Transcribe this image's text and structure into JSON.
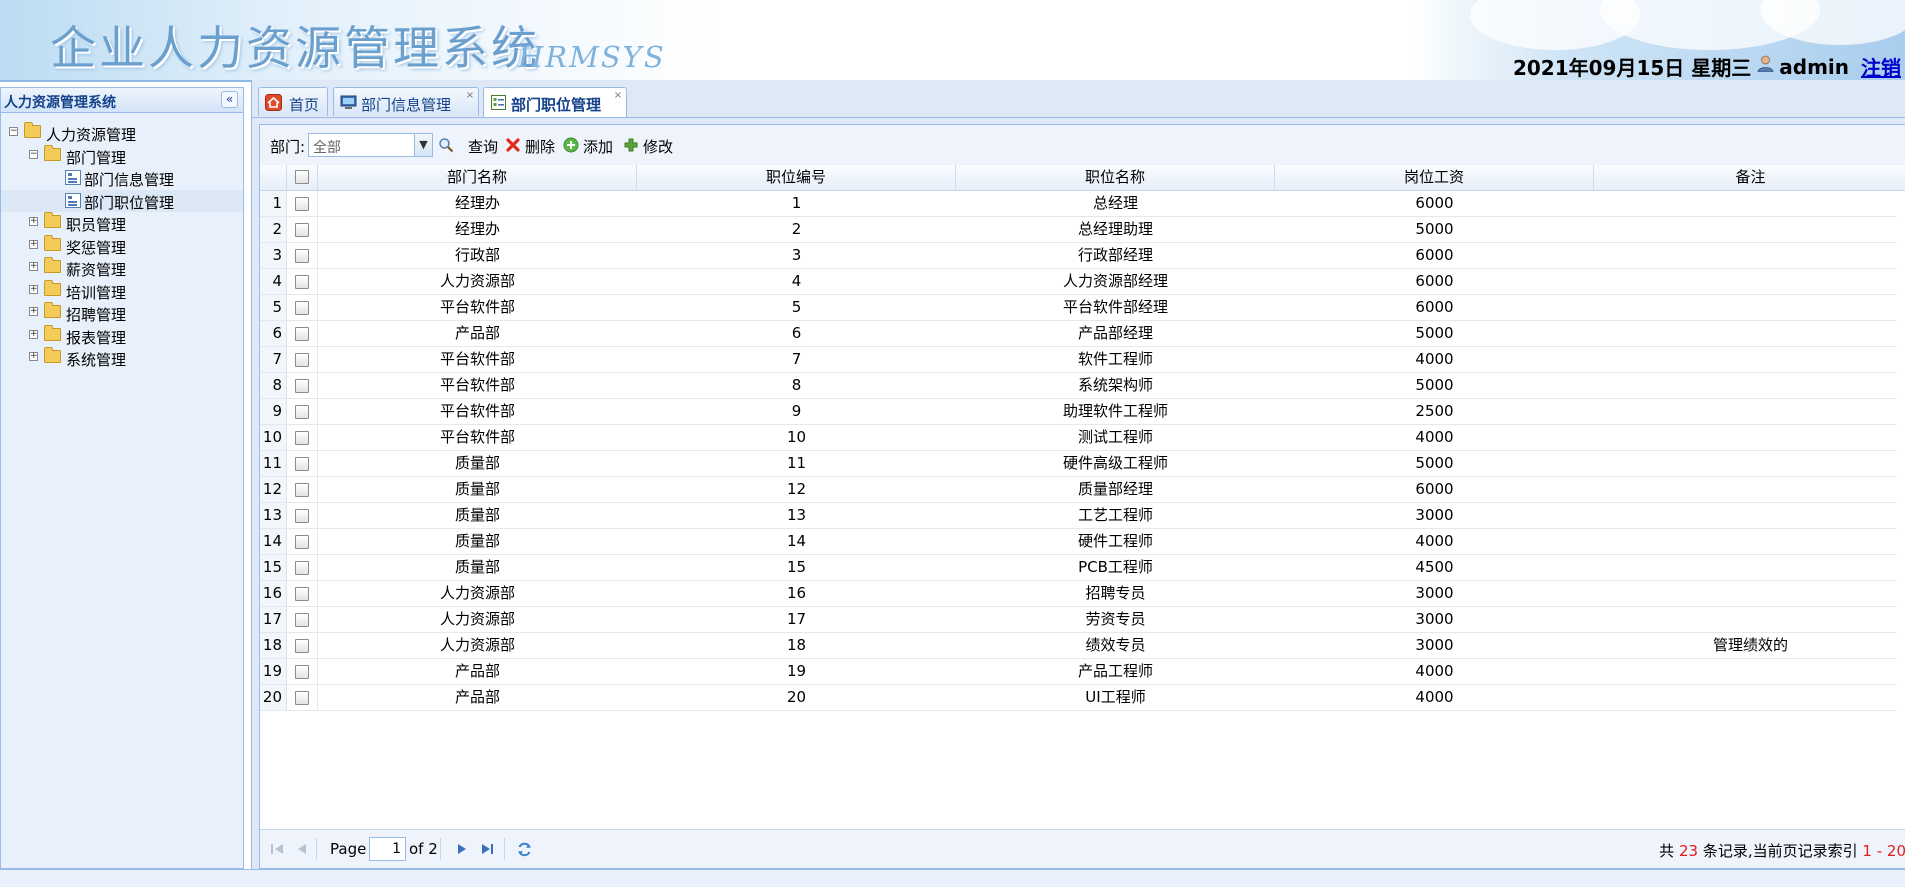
{
  "header": {
    "title": "企业人力资源管理系统",
    "subtitle": "HRMSYS",
    "datetime": "2021年09月15日 星期三",
    "username": "admin",
    "logout_label": "注销"
  },
  "sidebar": {
    "title": "人力资源管理系统",
    "tree": [
      {
        "label": "人力资源管理",
        "level": 0,
        "type": "folder",
        "expanded": true
      },
      {
        "label": "部门管理",
        "level": 1,
        "type": "folder",
        "expanded": true
      },
      {
        "label": "部门信息管理",
        "level": 2,
        "type": "page"
      },
      {
        "label": "部门职位管理",
        "level": 2,
        "type": "page",
        "selected": true
      },
      {
        "label": "职员管理",
        "level": 1,
        "type": "folder",
        "expanded": false
      },
      {
        "label": "奖惩管理",
        "level": 1,
        "type": "folder",
        "expanded": false
      },
      {
        "label": "薪资管理",
        "level": 1,
        "type": "folder",
        "expanded": false
      },
      {
        "label": "培训管理",
        "level": 1,
        "type": "folder",
        "expanded": false
      },
      {
        "label": "招聘管理",
        "level": 1,
        "type": "folder",
        "expanded": false
      },
      {
        "label": "报表管理",
        "level": 1,
        "type": "folder",
        "expanded": false
      },
      {
        "label": "系统管理",
        "level": 1,
        "type": "folder",
        "expanded": false
      }
    ]
  },
  "tabs": [
    {
      "label": "首页",
      "icon": "home-icon",
      "closable": false,
      "active": false
    },
    {
      "label": "部门信息管理",
      "icon": "monitor-icon",
      "closable": true,
      "active": false
    },
    {
      "label": "部门职位管理",
      "icon": "form-icon",
      "closable": true,
      "active": true
    }
  ],
  "toolbar": {
    "dept_label": "部门:",
    "dept_value": "全部",
    "query_label": "查询",
    "delete_label": "删除",
    "add_label": "添加",
    "edit_label": "修改"
  },
  "table": {
    "columns": [
      "部门名称",
      "职位编号",
      "职位名称",
      "岗位工资",
      "备注"
    ],
    "rows": [
      [
        "经理办",
        "1",
        "总经理",
        "6000",
        ""
      ],
      [
        "经理办",
        "2",
        "总经理助理",
        "5000",
        ""
      ],
      [
        "行政部",
        "3",
        "行政部经理",
        "6000",
        ""
      ],
      [
        "人力资源部",
        "4",
        "人力资源部经理",
        "6000",
        ""
      ],
      [
        "平台软件部",
        "5",
        "平台软件部经理",
        "6000",
        ""
      ],
      [
        "产品部",
        "6",
        "产品部经理",
        "5000",
        ""
      ],
      [
        "平台软件部",
        "7",
        "软件工程师",
        "4000",
        ""
      ],
      [
        "平台软件部",
        "8",
        "系统架构师",
        "5000",
        ""
      ],
      [
        "平台软件部",
        "9",
        "助理软件工程师",
        "2500",
        ""
      ],
      [
        "平台软件部",
        "10",
        "测试工程师",
        "4000",
        ""
      ],
      [
        "质量部",
        "11",
        "硬件高级工程师",
        "5000",
        ""
      ],
      [
        "质量部",
        "12",
        "质量部经理",
        "6000",
        ""
      ],
      [
        "质量部",
        "13",
        "工艺工程师",
        "3000",
        ""
      ],
      [
        "质量部",
        "14",
        "硬件工程师",
        "4000",
        ""
      ],
      [
        "质量部",
        "15",
        "PCB工程师",
        "4500",
        ""
      ],
      [
        "人力资源部",
        "16",
        "招聘专员",
        "3000",
        ""
      ],
      [
        "人力资源部",
        "17",
        "劳资专员",
        "3000",
        ""
      ],
      [
        "人力资源部",
        "18",
        "绩效专员",
        "3000",
        "管理绩效的"
      ],
      [
        "产品部",
        "19",
        "产品工程师",
        "4000",
        ""
      ],
      [
        "产品部",
        "20",
        "UI工程师",
        "4000",
        ""
      ]
    ]
  },
  "pager": {
    "page_label": "Page",
    "page_value": "1",
    "of_label": "of 2",
    "summary_prefix": "共",
    "total": "23",
    "summary_middle": "条记录,当前页记录索引",
    "range": "1 - 20"
  },
  "colors": {
    "accent": "#15428b",
    "border": "#99bbe8",
    "highlight": "#e21b1b"
  }
}
